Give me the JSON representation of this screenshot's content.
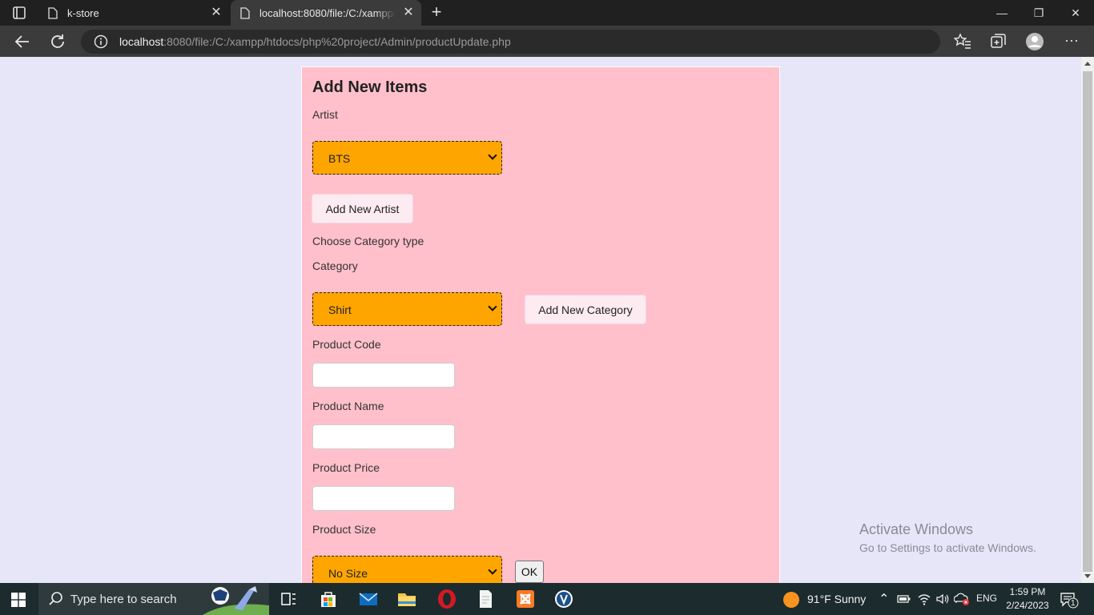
{
  "browser": {
    "tabs": [
      {
        "title": "k-store",
        "active": false
      },
      {
        "title": "localhost:8080/file:/C:/xampp/htdocs/php%20project/Admin/productUpdate.php",
        "active": true
      }
    ],
    "address": {
      "host": "localhost",
      "rest": ":8080/file:/C:/xampp/htdocs/php%20project/Admin/productUpdate.php"
    }
  },
  "form": {
    "heading": "Add New Items",
    "artist_label": "Artist",
    "artist_selected": "BTS",
    "add_artist_label": "Add New Artist",
    "category_type_label": "Choose Category type",
    "category_label": "Category",
    "category_selected": "Shirt",
    "add_category_label": "Add New Category",
    "product_code_label": "Product Code",
    "product_code_value": "",
    "product_name_label": "Product Name",
    "product_name_value": "",
    "product_price_label": "Product Price",
    "product_price_value": "",
    "product_size_label": "Product Size",
    "size_selected": "No Size",
    "ok_label": "OK"
  },
  "watermark": {
    "line1": "Activate Windows",
    "line2": "Go to Settings to activate Windows."
  },
  "taskbar": {
    "search_placeholder": "Type here to search",
    "weather": "91°F  Sunny",
    "lang": "ENG",
    "time": "1:59 PM",
    "date": "2/24/2023",
    "notification_count": "1"
  },
  "colors": {
    "page_bg": "#e6e6f8",
    "card_bg": "#ffc0cb",
    "select_bg": "#ffa500"
  }
}
